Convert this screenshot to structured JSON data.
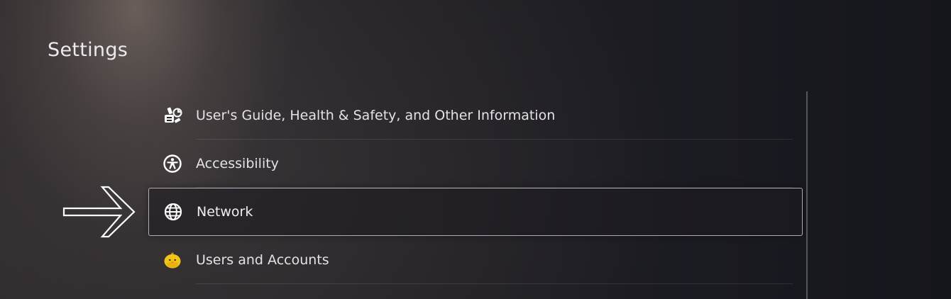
{
  "header": {
    "title": "Settings"
  },
  "menu": {
    "items": [
      {
        "label": "User's Guide, Health & Safety, and Other Information",
        "icon": "info-guide-icon"
      },
      {
        "label": "Accessibility",
        "icon": "accessibility-icon"
      },
      {
        "label": "Network",
        "icon": "globe-icon",
        "focused": true
      },
      {
        "label": "Users and Accounts",
        "icon": "avatar-chick-icon"
      }
    ]
  },
  "colors": {
    "text": "#e4e2e6",
    "focus_border": "#e1dce1",
    "avatar_yellow": "#f2c417"
  }
}
